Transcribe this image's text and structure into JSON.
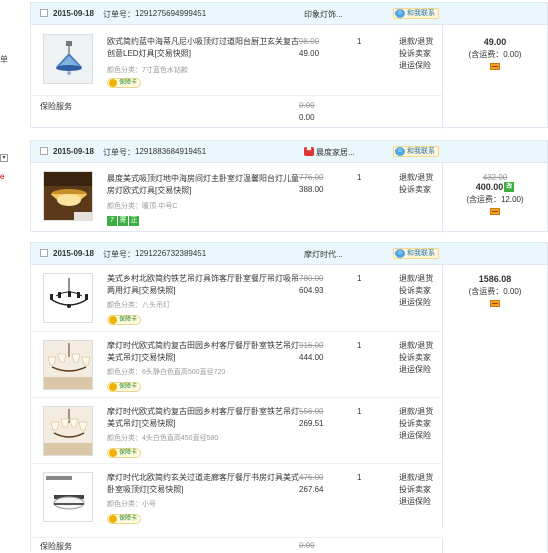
{
  "left_marks": [
    "单",
    "▾",
    "e"
  ],
  "orders": [
    {
      "date": "2015-09-18",
      "order_label": "订单号：",
      "order_number": "1291275694999451",
      "store": "印象灯饰...",
      "store_has_icon": false,
      "contact_label": "和我联系",
      "total": "49.00",
      "shipping": "(含运费：0.00)",
      "items": [
        {
          "title": "欧式简约蓝中海蒂凡尼小吸顶灯过道阳台厨卫玄关复古创意LED灯具[交易快照]",
          "spec": "颜色分类：7寸蓝色水钻款",
          "orig": "98.00",
          "price": "49.00",
          "qty": "1",
          "actions": [
            "退款/退货",
            "投诉卖家",
            "退运保险"
          ],
          "badge": "保障卡",
          "thumb": "blue-lamp"
        }
      ],
      "service": {
        "label": "保险服务",
        "orig": "0.00",
        "price": "0.00"
      }
    },
    {
      "date": "2015-09-18",
      "order_label": "订单号：",
      "order_number": "1291883684919451",
      "store": "晨度家居...",
      "store_has_icon": true,
      "contact_label": "和我联系",
      "total": "400.00",
      "total_tag": "改",
      "shipping": "(含运费：12.00)",
      "items": [
        {
          "title": "晨度美式吸顶灯地中海房间灯主卧室灯温馨阳台灯儿童房灯欧式灯具[交易快照]",
          "spec": "颜色分类：暖顶·中号C",
          "orig": "776.00",
          "price": "388.00",
          "qty": "1",
          "actions": [
            "退款/退货",
            "投诉卖家"
          ],
          "tags": [
            "7",
            "寄",
            "正"
          ],
          "thumb": "ceiling-lamp"
        }
      ]
    },
    {
      "date": "2015-09-18",
      "order_label": "订单号：",
      "order_number": "1291226732389451",
      "store": "摩灯时代...",
      "store_has_icon": false,
      "contact_label": "和我联系",
      "total": "1586.08",
      "shipping": "(含运费：0.00)",
      "items": [
        {
          "title": "美式乡村北欧简约铁艺吊灯具饰客厅卧室餐厅吊灯吸吊两用灯具[交易快照]",
          "spec": "颜色分类：八头吊灯",
          "orig": "780.00",
          "price": "604.93",
          "qty": "1",
          "actions": [
            "退款/退货",
            "投诉卖家",
            "退运保险"
          ],
          "badge": "保障卡",
          "thumb": "iron-chandelier"
        },
        {
          "title": "摩灯时代欧式简约复古田园乡村客厅餐厅卧室铁艺吊灯 美式吊灯[交易快照]",
          "spec": "颜色分类：6头静白色直高500直径720",
          "orig": "916.00",
          "price": "444.00",
          "qty": "1",
          "actions": [
            "退款/退货",
            "投诉卖家",
            "退运保险"
          ],
          "badge": "保障卡",
          "thumb": "white-chandelier"
        },
        {
          "title": "摩灯时代欧式简约复古田园乡村客厅餐厅卧室铁艺吊灯 美式吊灯[交易快照]",
          "spec": "颜色分类：4头白色直高450直径580",
          "orig": "556.00",
          "price": "269.51",
          "qty": "1",
          "actions": [
            "退款/退货",
            "投诉卖家",
            "退运保险"
          ],
          "badge": "保障卡",
          "thumb": "white-chandelier"
        },
        {
          "title": "摩灯时代北欧简约玄关过道走廊客厅餐厅书房灯具美式卧室吸顶灯[交易快照]",
          "spec": "颜色分类：小号",
          "orig": "476.00",
          "price": "267.64",
          "qty": "1",
          "actions": [
            "退款/退货",
            "投诉卖家",
            "退运保险"
          ],
          "badge": "保障卡",
          "thumb": "flush-mount"
        }
      ],
      "service": {
        "label": "保险服务",
        "orig": "0.00",
        "price": "0.00"
      }
    }
  ]
}
